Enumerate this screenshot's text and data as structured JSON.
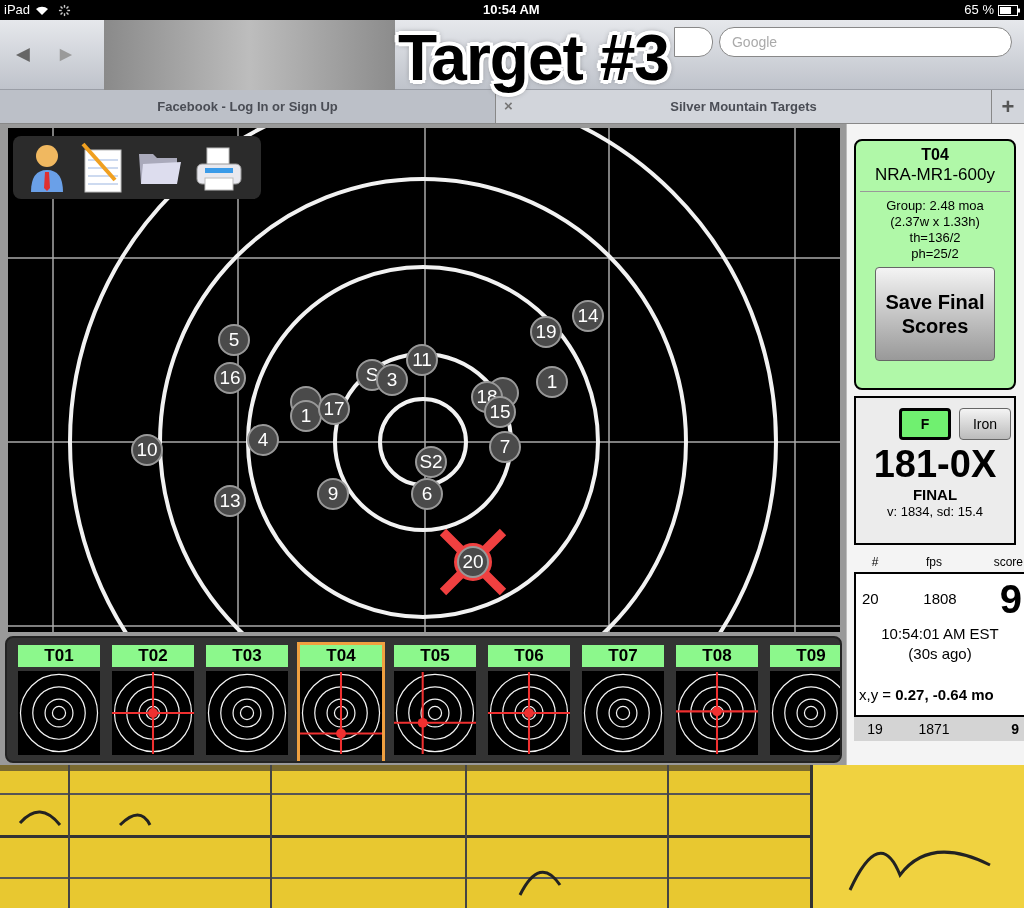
{
  "status_bar": {
    "device": "iPad",
    "time": "10:54 AM",
    "battery": "65 %"
  },
  "overlay_title": "Target #3",
  "browser": {
    "search": {
      "placeholder": "Google"
    },
    "tabs": [
      {
        "label": "Facebook - Log In or Sign Up",
        "selected": false
      },
      {
        "label": "Silver Mountain Targets",
        "selected": true,
        "close": "×"
      }
    ],
    "new_tab": "+"
  },
  "shots": [
    {
      "label": "10",
      "last": false
    },
    {
      "label": "5",
      "last": false
    },
    {
      "label": "16",
      "last": false
    },
    {
      "label": "4",
      "last": false
    },
    {
      "label": "13",
      "last": false
    },
    {
      "label": "9",
      "last": false
    },
    {
      "last": false
    },
    {
      "label": "1",
      "last": false
    },
    {
      "label": "17",
      "last": false
    },
    {
      "label": "S",
      "last": false
    },
    {
      "label": "3",
      "last": false
    },
    {
      "label": "11",
      "last": false
    },
    {
      "last": false
    },
    {
      "label": "18",
      "last": false
    },
    {
      "label": "15",
      "last": false
    },
    {
      "label": "7",
      "last": false
    },
    {
      "label": "1",
      "last": false
    },
    {
      "label": "19",
      "last": false
    },
    {
      "label": "14",
      "last": false
    },
    {
      "label": "S2",
      "last": false
    },
    {
      "label": "6",
      "last": false
    },
    {
      "label": "20",
      "last": true
    }
  ],
  "thumbnails": [
    {
      "label": "T01",
      "selected": false,
      "marked": false
    },
    {
      "label": "T02",
      "selected": false,
      "marked": true
    },
    {
      "label": "T03",
      "selected": false,
      "marked": false
    },
    {
      "label": "T04",
      "selected": true,
      "marked": true
    },
    {
      "label": "T05",
      "selected": false,
      "marked": true
    },
    {
      "label": "T06",
      "selected": false,
      "marked": true
    },
    {
      "label": "T07",
      "selected": false,
      "marked": false
    },
    {
      "label": "T08",
      "selected": false,
      "marked": true
    },
    {
      "label": "T09",
      "selected": false,
      "marked": false
    }
  ],
  "summary": {
    "target": "T04",
    "course": "NRA-MR1-600y",
    "stats": [
      "Group: 2.48 moa",
      "(2.37w x 1.33h)",
      "th=136/2",
      "ph=25/2"
    ],
    "save_button": "Save Final Scores"
  },
  "score": {
    "modes": [
      {
        "label": "F",
        "selected": true
      },
      {
        "label": "Iron",
        "selected": false
      }
    ],
    "total": "181-0X",
    "status": "FINAL",
    "velocity": "v: 1834, sd: 15.4"
  },
  "shot_table": {
    "columns": [
      "#",
      "fps",
      "score"
    ],
    "current": {
      "number": "20",
      "fps": "1808",
      "score": "9",
      "time": "10:54:01 AM EST",
      "ago": "(30s ago)",
      "position": "x,y = **0.27, -0.64 mo**"
    },
    "rows": [
      {
        "number": "19",
        "fps": "1871",
        "score": "9"
      }
    ]
  }
}
